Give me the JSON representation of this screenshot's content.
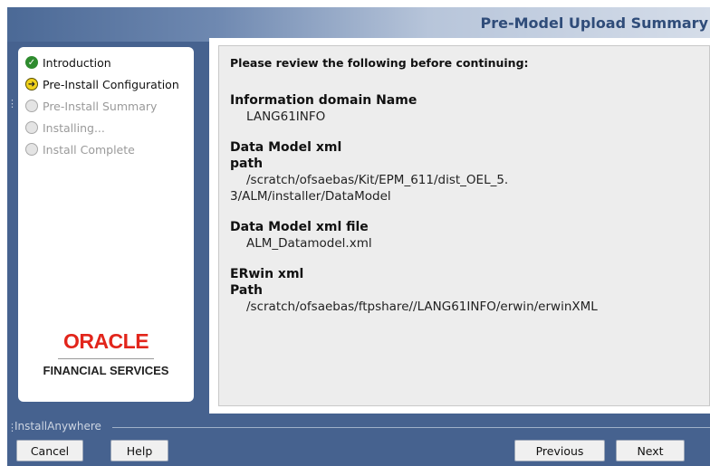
{
  "window": {
    "title": "Pre-Model Upload Summary"
  },
  "steps": [
    {
      "label": "Introduction",
      "state": "done"
    },
    {
      "label": "Pre-Install Configuration",
      "state": "current"
    },
    {
      "label": "Pre-Install Summary",
      "state": "pending"
    },
    {
      "label": "Installing...",
      "state": "pending"
    },
    {
      "label": "Install Complete",
      "state": "pending"
    }
  ],
  "logo": {
    "brand": "ORACLE",
    "tagline": "FINANCIAL SERVICES"
  },
  "content": {
    "heading": "Please review the following before continuing:",
    "info_domain": {
      "label": "Information domain Name",
      "value": "LANG61INFO"
    },
    "dm_xml_path": {
      "label1": "Data Model xml",
      "label2": "path",
      "value1": "/scratch/ofsaebas/Kit/EPM_611/dist_OEL_5.",
      "value2": "3/ALM/installer/DataModel"
    },
    "dm_xml_file": {
      "label": "Data Model xml file",
      "value": "ALM_Datamodel.xml"
    },
    "erwin": {
      "label1": "ERwin xml",
      "label2": "Path",
      "value": "/scratch/ofsaebas/ftpshare//LANG61INFO/erwin/erwinXML"
    }
  },
  "footer": {
    "vendor": "InstallAnywhere",
    "cancel_label": "Cancel",
    "help_label": "Help",
    "previous_label": "Previous",
    "next_label": "Next"
  },
  "colors": {
    "window_bg": "#46628f",
    "brand_red": "#e2251b",
    "done_green": "#2e8b2e",
    "current_yellow": "#f1d21b"
  }
}
